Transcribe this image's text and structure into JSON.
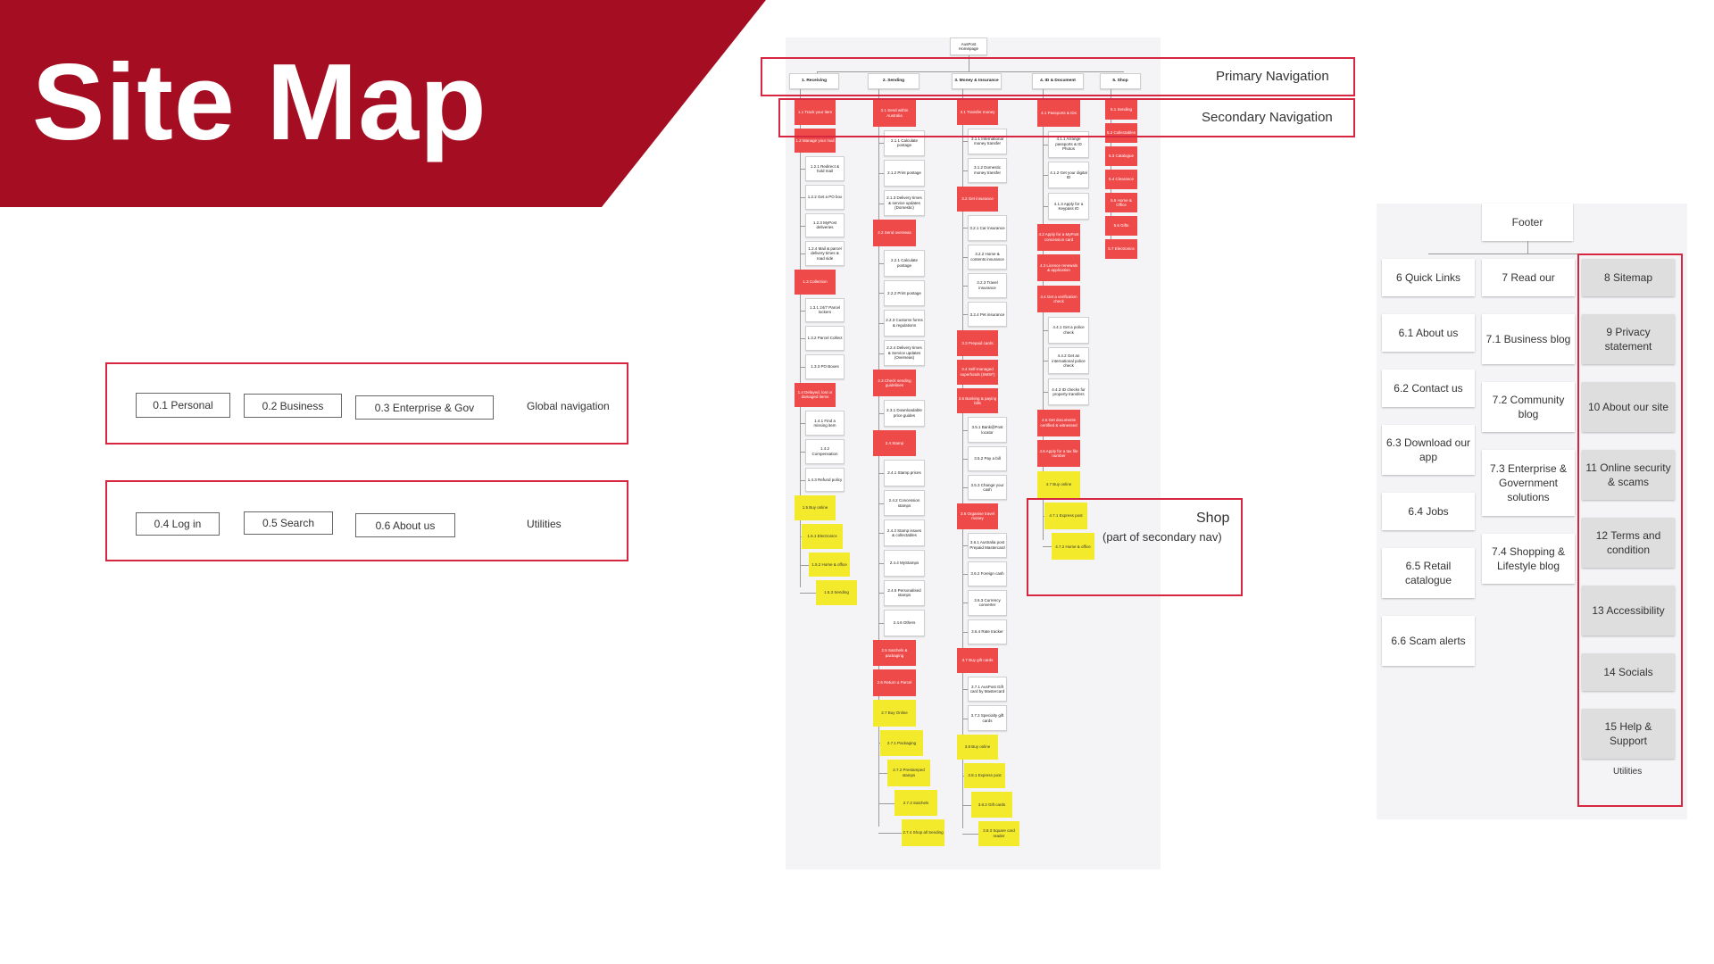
{
  "page_title": "Site Map",
  "global_navigation": {
    "label": "Global navigation",
    "items": [
      "0.1 Personal",
      "0.2 Business",
      "0.3 Enterprise & Gov"
    ]
  },
  "utilities": {
    "label": "Utilities",
    "items": [
      "0.4 Log in",
      "0.5 Search",
      "0.6 About us"
    ]
  },
  "sitemap": {
    "root": "AusPost Homepage",
    "primary_nav_label": "Primary Navigation",
    "secondary_nav_label": "Secondary Navigation",
    "shop_label": "Shop",
    "shop_sublabel": "(part of secondary nav)",
    "columns": [
      {
        "header": "1. Receiving",
        "children": [
          {
            "label": "1.1 Track your item",
            "type": "red"
          },
          {
            "label": "1.2 Manage your mail",
            "type": "red"
          },
          {
            "label": "1.2.1 Redirect & hold mail",
            "type": "white"
          },
          {
            "label": "1.2.2 Get a PO box",
            "type": "white"
          },
          {
            "label": "1.2.3 MyPost deliveries",
            "type": "white"
          },
          {
            "label": "1.2.4 Mail & parcel delivery times & road side",
            "type": "white"
          },
          {
            "label": "1.3 Collection",
            "type": "red"
          },
          {
            "label": "1.3.1 24/7 Parcel lockers",
            "type": "white"
          },
          {
            "label": "1.3.2 Parcel Collect",
            "type": "white"
          },
          {
            "label": "1.3.3 PO Boxes",
            "type": "white"
          },
          {
            "label": "1.4 Delayed, lost or damaged items",
            "type": "red"
          },
          {
            "label": "1.4.1 Find a missing item",
            "type": "white"
          },
          {
            "label": "1.4.2 Compensation",
            "type": "white"
          },
          {
            "label": "1.4.3 Refund policy",
            "type": "white"
          },
          {
            "label": "1.5 Buy online",
            "type": "yellow"
          },
          {
            "label": "1.5.1 Electronics",
            "type": "yellow"
          },
          {
            "label": "1.5.2 Home & office",
            "type": "yellow"
          },
          {
            "label": "1.5.3 Sending",
            "type": "yellow"
          }
        ]
      },
      {
        "header": "2. Sending",
        "children": [
          {
            "label": "2.1 Send within Australia",
            "type": "red"
          },
          {
            "label": "2.1.1 Calculate postage",
            "type": "white"
          },
          {
            "label": "2.1.2 Print postage",
            "type": "white"
          },
          {
            "label": "2.1.3 Delivery times & service updates (Domestic)",
            "type": "white"
          },
          {
            "label": "2.2 Send overseas",
            "type": "red"
          },
          {
            "label": "2.2.1 Calculate postage",
            "type": "white"
          },
          {
            "label": "2.2.2 Print postage",
            "type": "white"
          },
          {
            "label": "2.2.3 Customs forms & regulations",
            "type": "white"
          },
          {
            "label": "2.2.4 Delivery times & Service updates (Overseas)",
            "type": "white"
          },
          {
            "label": "2.3 Check sending guidelines",
            "type": "red"
          },
          {
            "label": "2.3.1 Downloadable price guides",
            "type": "white"
          },
          {
            "label": "2.4 Stamp",
            "type": "red"
          },
          {
            "label": "2.4.1 Stamp prices",
            "type": "white"
          },
          {
            "label": "2.4.2 Concession stamps",
            "type": "white"
          },
          {
            "label": "2.4.3 Stamp issues & collectables",
            "type": "white"
          },
          {
            "label": "2.4.4 MyStamps",
            "type": "white"
          },
          {
            "label": "2.4.5 Personalised stamps",
            "type": "white"
          },
          {
            "label": "2.4.6 Others",
            "type": "white"
          },
          {
            "label": "2.5 Satchels & packaging",
            "type": "red"
          },
          {
            "label": "2.6 Return a Parcel",
            "type": "red"
          },
          {
            "label": "2.7 Buy Online",
            "type": "yellow"
          },
          {
            "label": "2.7.1 Packaging",
            "type": "yellow"
          },
          {
            "label": "2.7.2 Prestamped stamps",
            "type": "yellow"
          },
          {
            "label": "2.7.3 Satchels",
            "type": "yellow"
          },
          {
            "label": "2.7.4 Shop all Sending",
            "type": "yellow"
          }
        ]
      },
      {
        "header": "3. Money & Insurance",
        "children": [
          {
            "label": "3.1 Transfer money",
            "type": "red"
          },
          {
            "label": "3.1.1 International money transfer",
            "type": "white"
          },
          {
            "label": "3.1.2 Domestic money transfer",
            "type": "white"
          },
          {
            "label": "3.2 Get insurance",
            "type": "red"
          },
          {
            "label": "3.2.1 Car insurance",
            "type": "white"
          },
          {
            "label": "3.2.2 Home & contents insurance",
            "type": "white"
          },
          {
            "label": "3.2.3 Travel insurance",
            "type": "white"
          },
          {
            "label": "3.2.4 Pet insurance",
            "type": "white"
          },
          {
            "label": "3.3 Prepaid cards",
            "type": "red"
          },
          {
            "label": "3.4 Self-managed superfunds (SMSF)",
            "type": "red"
          },
          {
            "label": "3.5 Banking & paying bills",
            "type": "red"
          },
          {
            "label": "3.5.1 Bank@Post locator",
            "type": "white"
          },
          {
            "label": "3.5.2 Pay a bill",
            "type": "white"
          },
          {
            "label": "3.5.3 Change your cash",
            "type": "white"
          },
          {
            "label": "3.6 Organise travel money",
            "type": "red"
          },
          {
            "label": "3.6.1 Australia post Prepaid Mastercard",
            "type": "white"
          },
          {
            "label": "3.6.2 Foreign cash",
            "type": "white"
          },
          {
            "label": "3.6.3 Currency converter",
            "type": "white"
          },
          {
            "label": "3.6.4 Rate tracker",
            "type": "white"
          },
          {
            "label": "3.7 Buy gift cards",
            "type": "red"
          },
          {
            "label": "3.7.1 AusPost Gift card by Mastercard",
            "type": "white"
          },
          {
            "label": "3.7.2 Specialty gift cards",
            "type": "white"
          },
          {
            "label": "3.8 Buy online",
            "type": "yellow"
          },
          {
            "label": "3.8.1 Express post",
            "type": "yellow"
          },
          {
            "label": "3.8.2 Gift cards",
            "type": "yellow"
          },
          {
            "label": "3.8.3 Square card reader",
            "type": "yellow"
          }
        ]
      },
      {
        "header": "4. ID & Document",
        "children": [
          {
            "label": "4.1 Passports & IDs",
            "type": "red"
          },
          {
            "label": "4.1.1 Arrange passports & ID Photos",
            "type": "white"
          },
          {
            "label": "4.1.2 Get your digital ID",
            "type": "white"
          },
          {
            "label": "4.1.3 Apply for a Keypass ID",
            "type": "white"
          },
          {
            "label": "4.2 Apply for a MyPost concession card",
            "type": "red"
          },
          {
            "label": "4.3 Licence renewals & application",
            "type": "red"
          },
          {
            "label": "4.4 Get a verification check",
            "type": "red"
          },
          {
            "label": "4.4.1 Get a police check",
            "type": "white"
          },
          {
            "label": "4.4.2 Get an international police check",
            "type": "white"
          },
          {
            "label": "4.4.3 ID checks for property transfers",
            "type": "white"
          },
          {
            "label": "4.5 Get documents certified & witnessed",
            "type": "red"
          },
          {
            "label": "4.6 Apply for a tax file number",
            "type": "red"
          },
          {
            "label": "4.7 Buy online",
            "type": "yellow"
          },
          {
            "label": "4.7.1 Express post",
            "type": "yellow"
          },
          {
            "label": "4.7.2 Home & office",
            "type": "yellow"
          }
        ]
      },
      {
        "header": "5. Shop",
        "children": [
          {
            "label": "5.1 Sending",
            "type": "red"
          },
          {
            "label": "5.2 Collectables",
            "type": "red"
          },
          {
            "label": "5.3 Catalogue",
            "type": "red"
          },
          {
            "label": "5.4 Clearance",
            "type": "red"
          },
          {
            "label": "5.5 Home & Office",
            "type": "red"
          },
          {
            "label": "5.6 Gifts",
            "type": "red"
          },
          {
            "label": "5.7 Electronics",
            "type": "red"
          }
        ]
      }
    ]
  },
  "footer": {
    "title": "Footer",
    "columns": [
      [
        "6 Quick Links",
        "6.1 About us",
        "6.2 Contact us",
        "6.3 Download our app",
        "6.4 Jobs",
        "6.5 Retail catalogue",
        "6.6 Scam alerts"
      ],
      [
        "7 Read our",
        "7.1 Business blog",
        "7.2 Community blog",
        "7.3 Enterprise & Government solutions",
        "7.4 Shopping & Lifestyle blog"
      ],
      [
        "8 Sitemap",
        "9 Privacy statement",
        "10 About our site",
        "11 Online security & scams",
        "12 Terms and condition",
        "13 Accessibility",
        "14 Socials",
        "15 Help & Support"
      ]
    ],
    "utilities_label": "Utilities"
  },
  "colors": {
    "banner": "#a50e22",
    "frame": "#d62640",
    "node_red": "#ef4a4a",
    "node_yellow": "#f4ea2c",
    "footer_grey": "#dedede"
  }
}
